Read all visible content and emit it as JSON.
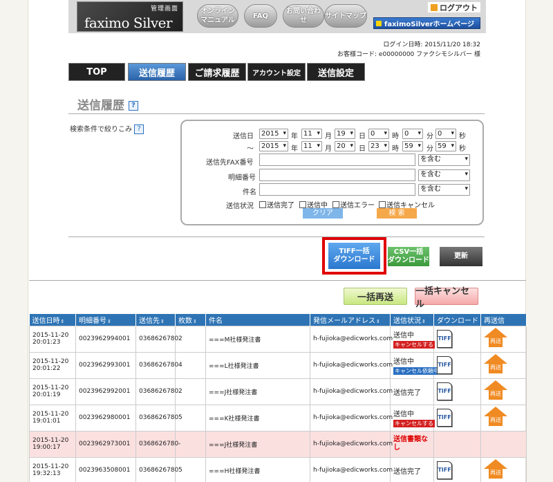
{
  "header": {
    "logo_kanri": "管理画面",
    "logo_title": "faximo Silver",
    "nav_pills": [
      "オンライン\nマニュアル",
      "FAQ",
      "お問い合わせ",
      "サイトマップ"
    ],
    "logout": "ログアウト",
    "home_link": "faximoSilverホームページ"
  },
  "user_info": {
    "login_time": "ログイン日時: 2015/11/20  18:32",
    "customer": "お客様コード: e00000000    ファクシモシルバー  様"
  },
  "tabs": [
    "TOP",
    "送信履歴",
    "ご請求履歴",
    "アカウント設定",
    "送信設定"
  ],
  "page_title": "送信履歴",
  "filter": {
    "label": "検索条件で絞りこみ",
    "date_label": "送信日",
    "tilde": "〜",
    "from": {
      "year": "2015",
      "month": "11",
      "day": "19",
      "hour": "0",
      "min": "0",
      "sec": "0"
    },
    "to": {
      "year": "2015",
      "month": "11",
      "day": "20",
      "hour": "23",
      "min": "59",
      "sec": "59"
    },
    "units": {
      "year": "年",
      "month": "月",
      "day": "日",
      "hour": "時",
      "min": "分",
      "sec": "秒"
    },
    "fax_label": "送信先FAX番号",
    "detail_label": "明細番号",
    "subject_label": "件名",
    "match_option": "を含む",
    "status_label": "送信状況",
    "status_options": [
      "送信完了",
      "送信中",
      "送信エラー",
      "送信キャンセル"
    ],
    "clear_btn": "クリア",
    "search_btn": "検  索"
  },
  "actions": {
    "tiff_dl": "TIFF一括\nダウンロード",
    "csv_dl": "CSV一括\nダウンロード",
    "refresh": "更新",
    "bulk_resend": "一括再送",
    "bulk_cancel": "一括キャンセル"
  },
  "table": {
    "headers": [
      "送信日時",
      "明細番号",
      "送信先",
      "枚数",
      "件名",
      "発信メールアドレス",
      "送信状況",
      "ダウンロード",
      "再送信"
    ],
    "tiff_label": "TIFF",
    "resend_label": "再送",
    "rows": [
      {
        "date": "2015-11-20",
        "time": "20:01:23",
        "id": "0023962994001",
        "to": "0368626780",
        "pages": "2",
        "subject": "===M社様発注書",
        "mail": "h-fujioka@edicworks.com",
        "status": "送信中",
        "badge": "キャンセルする",
        "badge_color": "#d42020",
        "tiff": true,
        "resend": true,
        "error": false
      },
      {
        "date": "2015-11-20",
        "time": "20:01:22",
        "id": "0023962993001",
        "to": "0368626780",
        "pages": "4",
        "subject": "===L社様発注書",
        "mail": "h-fujioka@edicworks.com",
        "status": "送信中",
        "badge": "キャンセル依頼中",
        "badge_color": "#2a6fc0",
        "tiff": true,
        "resend": true,
        "error": false
      },
      {
        "date": "2015-11-20",
        "time": "20:01:19",
        "id": "0023962992001",
        "to": "0368626780",
        "pages": "2",
        "subject": "===J社様発注書",
        "mail": "h-fujioka@edicworks.com",
        "status": "送信完了",
        "badge": "",
        "badge_color": "",
        "tiff": true,
        "resend": true,
        "error": false
      },
      {
        "date": "2015-11-20",
        "time": "19:01:01",
        "id": "0023962980001",
        "to": "0368626780",
        "pages": "5",
        "subject": "===K社様発注書",
        "mail": "h-fujioka@edicworks.com",
        "status": "送信中",
        "badge": "キャンセルする",
        "badge_color": "#d42020",
        "tiff": true,
        "resend": true,
        "error": false
      },
      {
        "date": "2015-11-20",
        "time": "19:00:17",
        "id": "0023962973001",
        "to": "0368626780",
        "pages": "-",
        "subject": "===J社様発注書",
        "mail": "h-fujioka@edicworks.com",
        "status": "送信書類なし",
        "badge": "",
        "badge_color": "",
        "tiff": false,
        "resend": false,
        "error": true
      },
      {
        "date": "2015-11-20",
        "time": "19:32:13",
        "id": "0023963508001",
        "to": "0368626780",
        "pages": "5",
        "subject": "===H社様発注書",
        "mail": "h-fujioka@edicworks.com",
        "status": "送信完了",
        "badge": "",
        "badge_color": "",
        "tiff": true,
        "resend": true,
        "error": false
      }
    ]
  }
}
